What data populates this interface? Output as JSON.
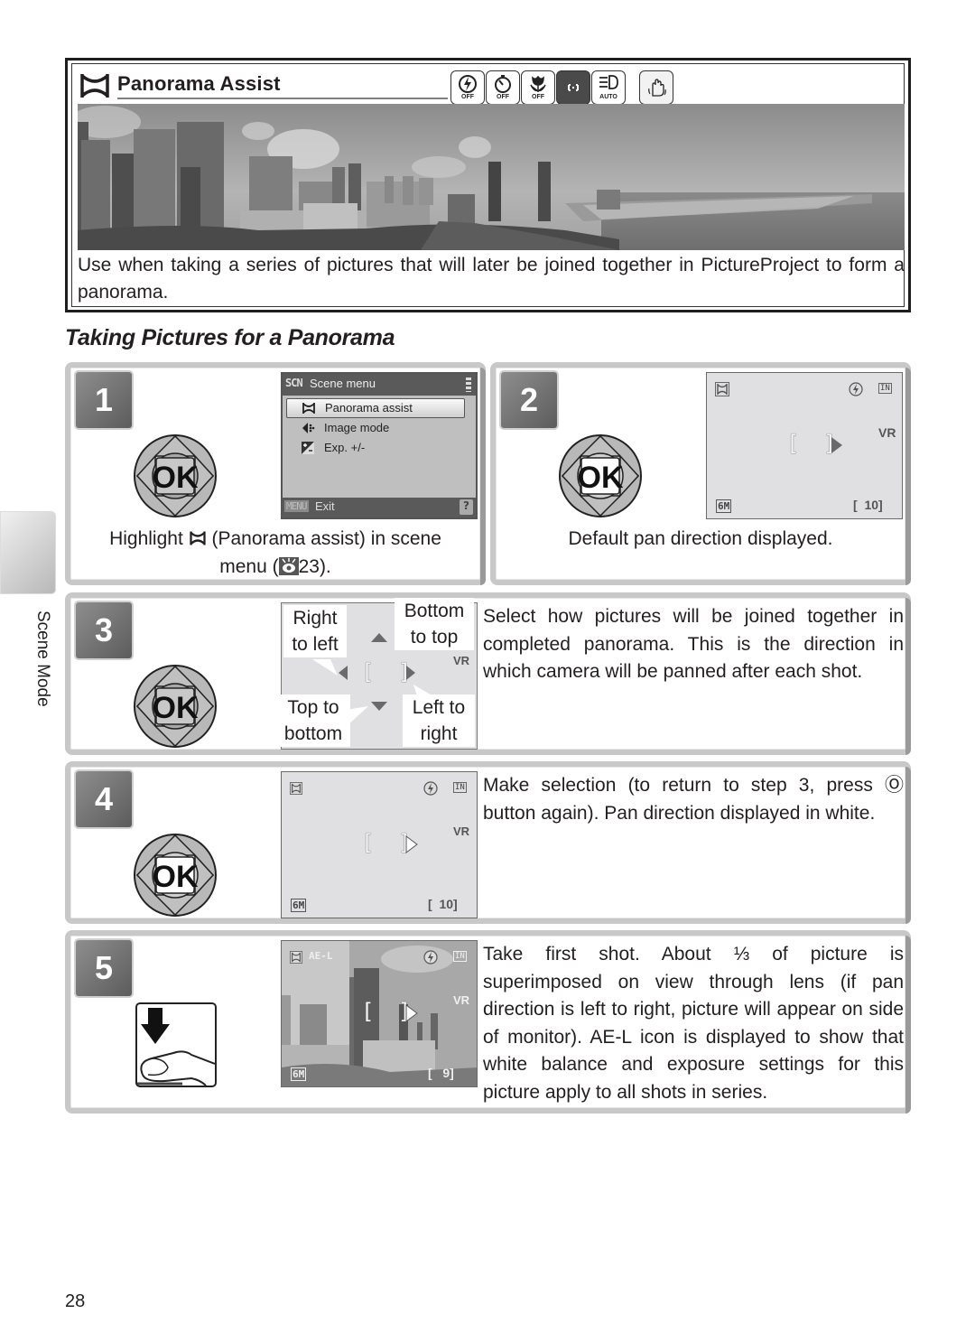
{
  "scene": {
    "title": "Panorama Assist",
    "title_icon": "panorama-assist-icon",
    "mode_icons": [
      {
        "name": "flash-off-icon",
        "sub": "OFF",
        "active": false
      },
      {
        "name": "self-timer-off-icon",
        "sub": "OFF",
        "active": false
      },
      {
        "name": "macro-off-icon",
        "sub": "OFF",
        "active": false
      },
      {
        "name": "focus-mode-icon",
        "sub": "",
        "active": true
      },
      {
        "name": "af-assist-auto-icon",
        "sub": "AUTO",
        "active": false
      },
      {
        "name": "vibration-reduction-hand-icon",
        "sub": "",
        "active": false
      }
    ],
    "photo_alt": "panoramic city skyline photo",
    "description": "Use when taking a series of pictures that will later be joined together in PictureProject to form a panorama."
  },
  "section_heading": "Taking Pictures for a Panorama",
  "side_tab": {
    "label": "Scene Mode"
  },
  "steps": [
    {
      "number": "1",
      "control": "ok-dpad",
      "text_pre": "Highlight",
      "text_mid": "(Panorama assist) in scene",
      "text_line2_pre": "menu (",
      "text_line2_ref": "23",
      "text_line2_post": ").",
      "screen": {
        "type": "scene-menu",
        "header_icon": "SCN",
        "header_title": "Scene menu",
        "items": [
          {
            "label": "Panorama assist",
            "icon": "panorama-assist-icon",
            "selected": true
          },
          {
            "label": "Image mode",
            "icon": "image-mode-icon",
            "selected": false
          },
          {
            "label": "Exp. +/-",
            "icon": "exposure-compensation-icon",
            "selected": false
          }
        ],
        "footer_menu": "MENU",
        "footer_exit": "Exit",
        "footer_help": "?"
      }
    },
    {
      "number": "2",
      "control": "ok-dpad",
      "text": "Default pan direction displayed.",
      "screen": {
        "type": "monitor",
        "count": "10",
        "image_mode": "6M",
        "vr": "VR",
        "mem": "IN"
      }
    },
    {
      "number": "3",
      "control": "ok-dpad",
      "callouts": {
        "right_to_left": [
          "Right",
          "to left"
        ],
        "bottom_to_top": [
          "Bottom",
          "to top"
        ],
        "top_to_bottom": [
          "Top to",
          "bottom"
        ],
        "left_to_right": [
          "Left to",
          "right"
        ]
      },
      "text": "Select how pictures will be joined together in completed panorama. This is the direction in which camera will be panned after each shot.",
      "screen": {
        "type": "direction-select",
        "vr": "VR"
      }
    },
    {
      "number": "4",
      "control": "ok-dpad",
      "text": "Make selection (to return to step 3, press Ⓞ button again). Pan direction displayed in white.",
      "screen": {
        "type": "monitor",
        "count": "10",
        "image_mode": "6M",
        "vr": "VR",
        "mem": "IN"
      }
    },
    {
      "number": "5",
      "control": "shutter-press",
      "text": "Take first shot. About ⅓ of picture is superimposed on view through lens (if pan direction is left to right, picture will appear on side of monitor). AE-L icon is displayed to show that white balance and exposure settings for this picture apply to all shots in series.",
      "screen": {
        "type": "monitor-photo",
        "count": "9",
        "image_mode": "6M",
        "vr": "VR",
        "mem": "IN",
        "ael": "AE-L"
      }
    }
  ],
  "page_number": "28",
  "ok_label": "OK",
  "colors": {
    "text": "#231f20",
    "panel_border": "#c8c8c8",
    "badge": "#6e6e6e",
    "monitor_bg": "#e0e0e2"
  }
}
